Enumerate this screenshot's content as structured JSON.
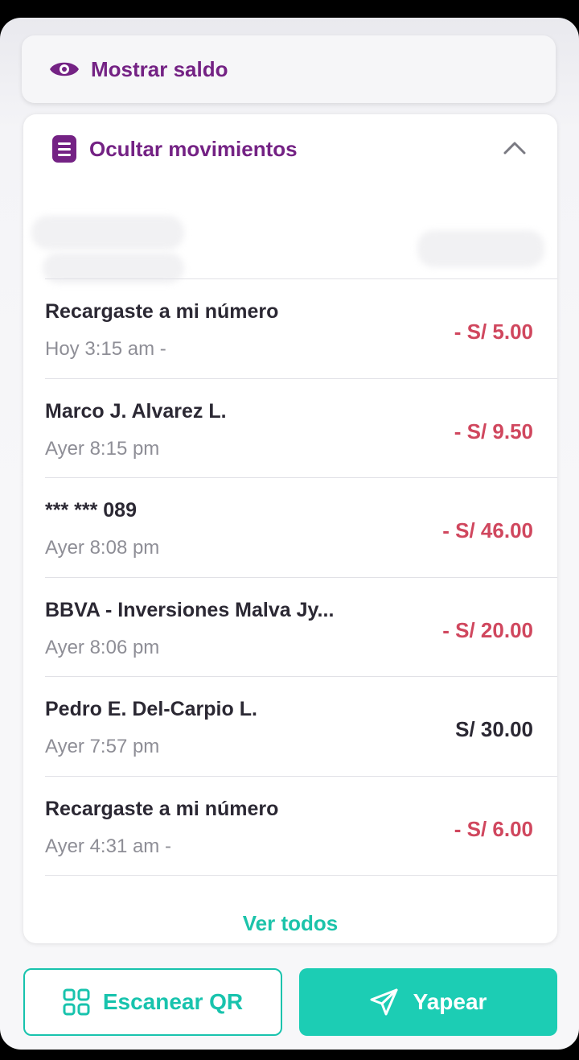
{
  "balance": {
    "label": "Mostrar saldo"
  },
  "movements": {
    "header_label": "Ocultar movimientos",
    "items": [
      {
        "name": "Recargaste a mi número",
        "time": "Hoy 3:15 am -",
        "amount": "- S/ 5.00",
        "type": "debit"
      },
      {
        "name": "Marco J. Alvarez L.",
        "time": "Ayer 8:15 pm",
        "amount": "- S/ 9.50",
        "type": "debit"
      },
      {
        "name": "*** *** 089",
        "time": "Ayer 8:08 pm",
        "amount": "- S/ 46.00",
        "type": "debit"
      },
      {
        "name": "BBVA -  Inversiones Malva   Jy...",
        "time": "Ayer 8:06 pm",
        "amount": "- S/ 20.00",
        "type": "debit"
      },
      {
        "name": "Pedro E. Del-Carpio L.",
        "time": "Ayer 7:57 pm",
        "amount": "S/ 30.00",
        "type": "credit"
      },
      {
        "name": "Recargaste a mi número",
        "time": "Ayer 4:31 am -",
        "amount": "- S/ 6.00",
        "type": "debit"
      }
    ],
    "see_all_label": "Ver todos"
  },
  "actions": {
    "scan_qr_label": "Escanear QR",
    "yapear_label": "Yapear"
  },
  "colors": {
    "brand_purple": "#742284",
    "accent_teal": "#1ccdb4",
    "debit_red": "#d0475e"
  }
}
